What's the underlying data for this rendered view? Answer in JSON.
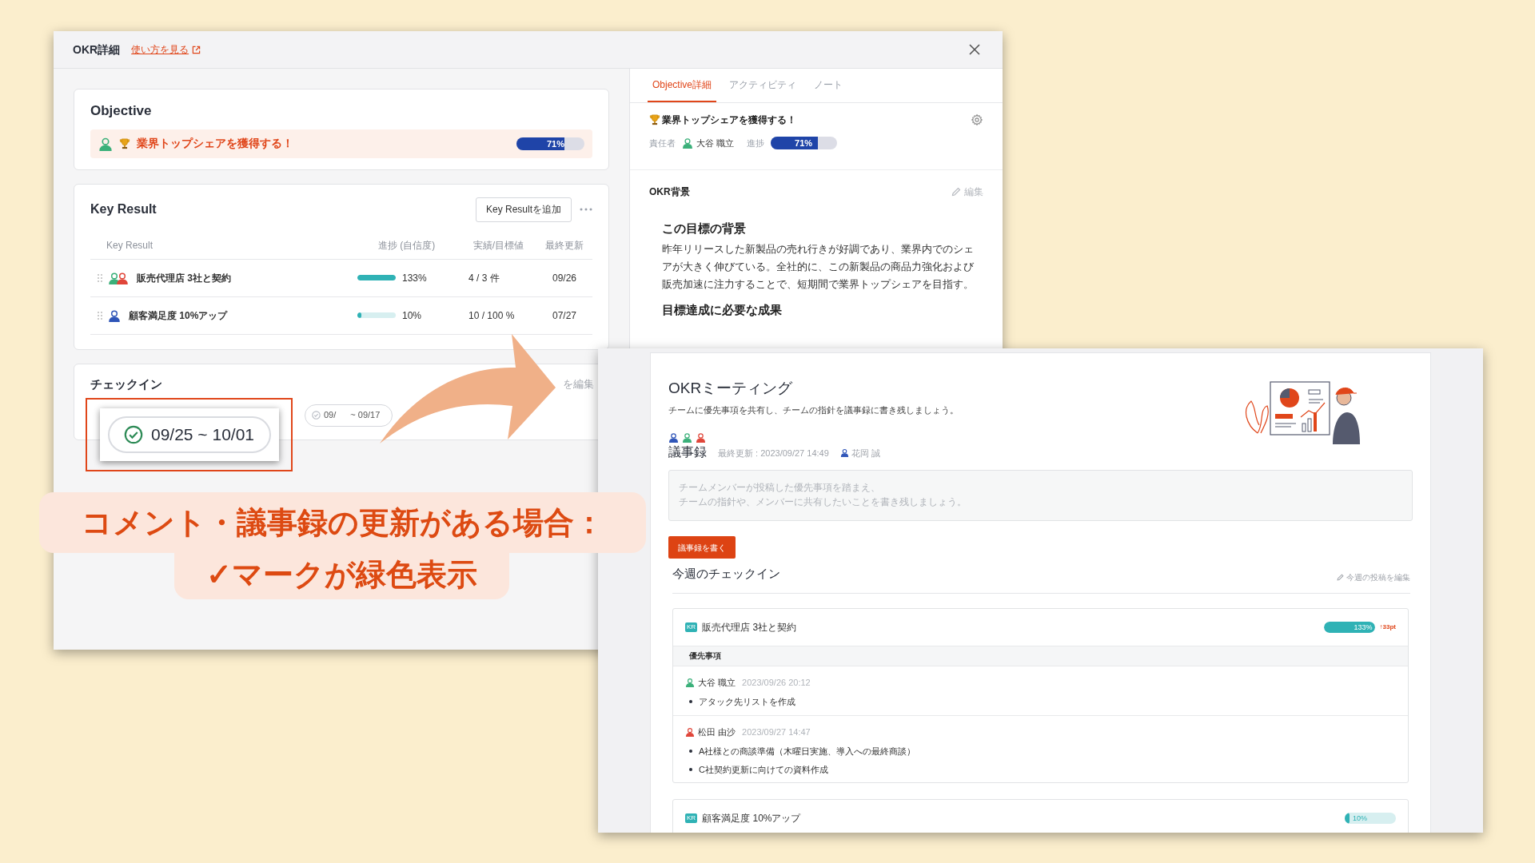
{
  "okr_window": {
    "title": "OKR詳細",
    "help_link": "使い方を見る",
    "objective_card": {
      "heading": "Objective",
      "owner_avatar": {
        "color": "#3bb07a"
      },
      "objective": "業界トップシェアを獲得する！",
      "progress": "71%",
      "level": 0.71
    },
    "key_result_card": {
      "heading": "Key Result",
      "add_button": "Key Resultを追加",
      "columns": [
        "Key Result",
        "進捗 (自信度)",
        "実績/目標値",
        "最終更新"
      ],
      "rows": [
        {
          "owners": [
            {
              "color": "#3bb07a"
            },
            {
              "color": "#e0463a"
            }
          ],
          "name": "販売代理店 3社と契約",
          "level": 1,
          "progress": "133%",
          "actual_target": "4 / 3 件",
          "updated": "09/26"
        },
        {
          "owners": [
            {
              "color": "#2f55b8"
            }
          ],
          "name": "顧客満足度 10%アップ",
          "level": 0.1,
          "progress": "10%",
          "actual_target": "10 / 100 %",
          "updated": "07/27"
        }
      ]
    },
    "checkin_card": {
      "heading": "チェックイン",
      "pill_parts": [
        "09/",
        "~ 09/17"
      ],
      "edit_link": "を編集"
    },
    "tabs": [
      {
        "label": "Objective詳細",
        "selected": true
      },
      {
        "label": "アクティビティ",
        "selected": false
      },
      {
        "label": "ノート",
        "selected": false
      }
    ],
    "objective_panel": {
      "title": "業界トップシェアを獲得する！",
      "owner_label": "責任者",
      "owner_avatar": {
        "color": "#3bb07a"
      },
      "owner": "大谷 職立",
      "progress_caption": "進捗",
      "progress": "71%",
      "level": 0.71
    },
    "background": {
      "heading": "OKR背景",
      "edit": "編集",
      "section_title": "この目標の背景",
      "text": "昨年リリースした新製品の売れ行きが好調であり、業界内でのシェアが大きく伸びている。全社的に、この新製品の商品力強化および販売加速に注力することで、短期間で業界トップシェアを目指す。",
      "next_title": "目標達成に必要な成果"
    }
  },
  "callout": {
    "date": "09/25 ~ 10/01",
    "checked": true
  },
  "banner": [
    "コメント・議事録の更新がある場合：",
    "✓マークが緑色表示"
  ],
  "meeting_window": {
    "title": "OKRミーティング",
    "subtitle": "チームに優先事項を共有し、チームの指針を議事録に書き残しましょう。",
    "members": [
      {
        "color": "#2f55b8"
      },
      {
        "color": "#3bb07a"
      },
      {
        "color": "#e0463a"
      }
    ],
    "minutes_heading": "議事録",
    "last_updated": "最終更新 : 2023/09/27 14:49",
    "author_avatar": {
      "color": "#2f55b8"
    },
    "author": "花岡 誠",
    "placeholder": [
      "チームメンバーが投稿した優先事項を踏まえ、",
      "チームの指針や、メンバーに共有したいことを書き残しましょう。"
    ],
    "write_button": "議事録を書く",
    "checkin_heading": "今週のチェックイン",
    "edit_link": "今週の投稿を編集",
    "kr_cards": [
      {
        "badge": "KR",
        "name": "販売代理店 3社と契約",
        "progress": "133%",
        "level": 1,
        "delta": "↑33pt",
        "section": "優先事項",
        "posts": [
          {
            "author": "大谷 職立",
            "color": "#3bb07a",
            "time": "2023/09/26 20:12",
            "items": [
              "アタック先リストを作成"
            ]
          },
          {
            "author": "松田 由沙",
            "color": "#e0463a",
            "time": "2023/09/27 14:47",
            "items": [
              "A社様との商談準備（木曜日実施、導入への最終商談）",
              "C社契約更新に向けての資料作成"
            ]
          }
        ]
      },
      {
        "badge": "KR",
        "name": "顧客満足度 10%アップ",
        "progress": "10%",
        "level": 0.1
      }
    ]
  }
}
